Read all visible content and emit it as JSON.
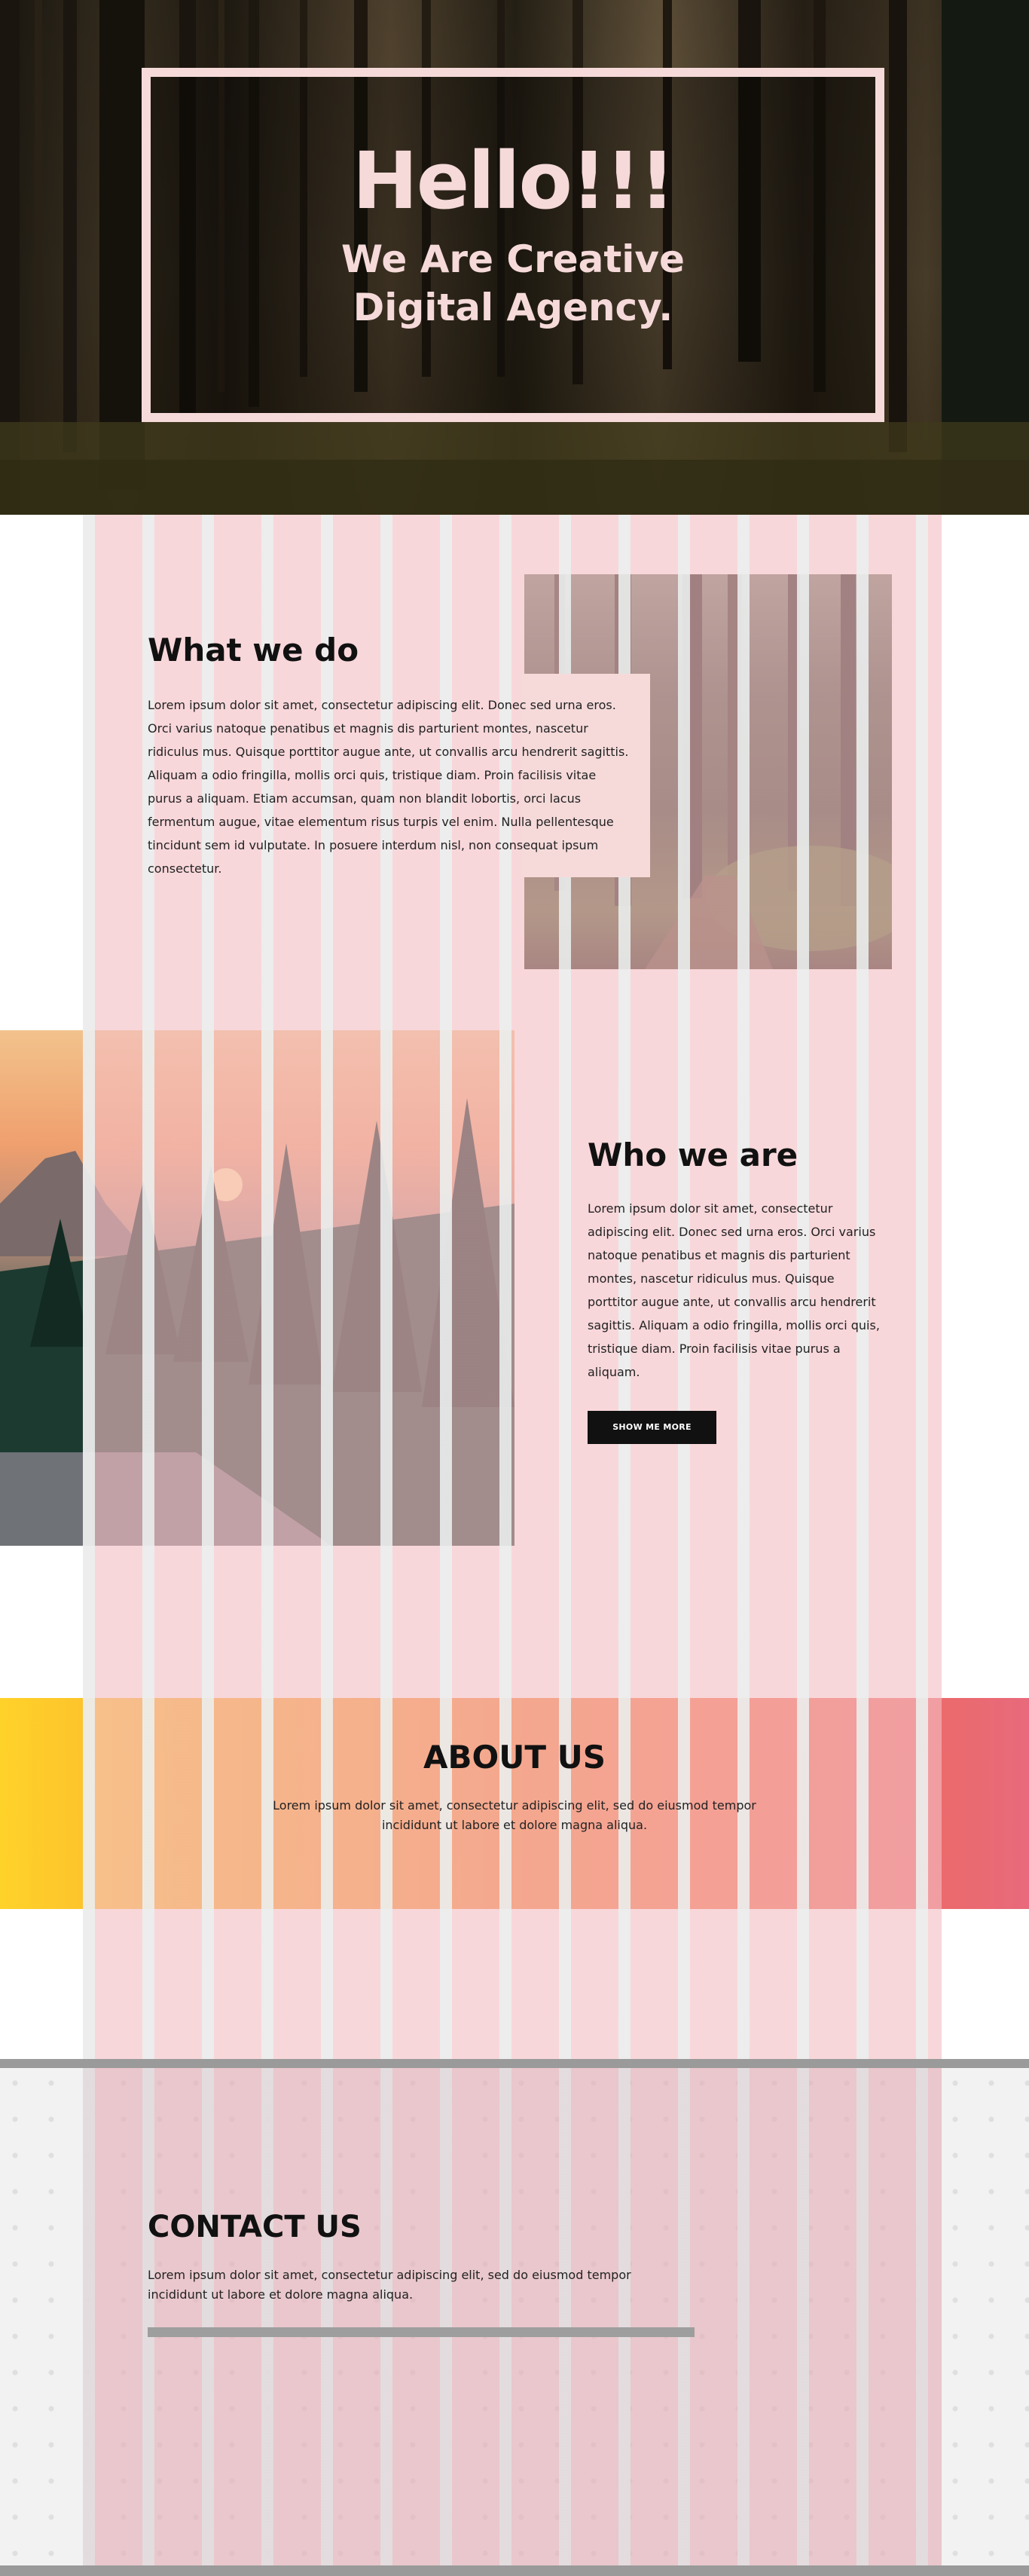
{
  "hero": {
    "title": "Hello!!!",
    "subtitle_line1": "We Are Creative",
    "subtitle_line2": "Digital Agency."
  },
  "what_we_do": {
    "title": "What we do",
    "body": "Lorem ipsum dolor sit amet, consectetur adipiscing elit. Donec sed urna eros. Orci varius natoque penatibus et magnis dis parturient montes, nascetur ridiculus mus. Quisque porttitor augue ante, ut convallis arcu hendrerit sagittis. Aliquam a odio fringilla, mollis orci quis, tristique diam. Proin facilisis vitae purus a aliquam. Etiam accumsan, quam non blandit lobortis, orci lacus fermentum augue, vitae elementum risus turpis vel enim. Nulla pellentesque tincidunt sem id vulputate. In posuere interdum nisl, non consequat ipsum consectetur."
  },
  "who_we_are": {
    "title": "Who we are",
    "body": "Lorem ipsum dolor sit amet, consectetur adipiscing elit. Donec sed urna eros. Orci varius natoque penatibus et magnis dis parturient montes, nascetur ridiculus mus. Quisque porttitor augue ante, ut convallis arcu hendrerit sagittis. Aliquam a odio fringilla, mollis orci quis, tristique diam. Proin facilisis vitae purus a aliquam.",
    "button_label": "SHOW ME MORE"
  },
  "about": {
    "title": "ABOUT US",
    "body": "Lorem ipsum dolor sit amet, consectetur adipiscing elit, sed do eiusmod tempor incididunt ut labore et dolore magna aliqua."
  },
  "contact": {
    "title": "CONTACT US",
    "body": "Lorem ipsum dolor sit amet, consectetur adipiscing elit, sed do eiusmod tempor incididunt ut labore et dolore magna aliqua."
  },
  "colors": {
    "hero_text": "#f6dada",
    "stripe_pink": "#f4bec4",
    "stripe_grey": "#ececec",
    "about_gradient_start": "#ffd22a",
    "about_gradient_end": "#e86a7c",
    "button_bg": "#111111"
  }
}
